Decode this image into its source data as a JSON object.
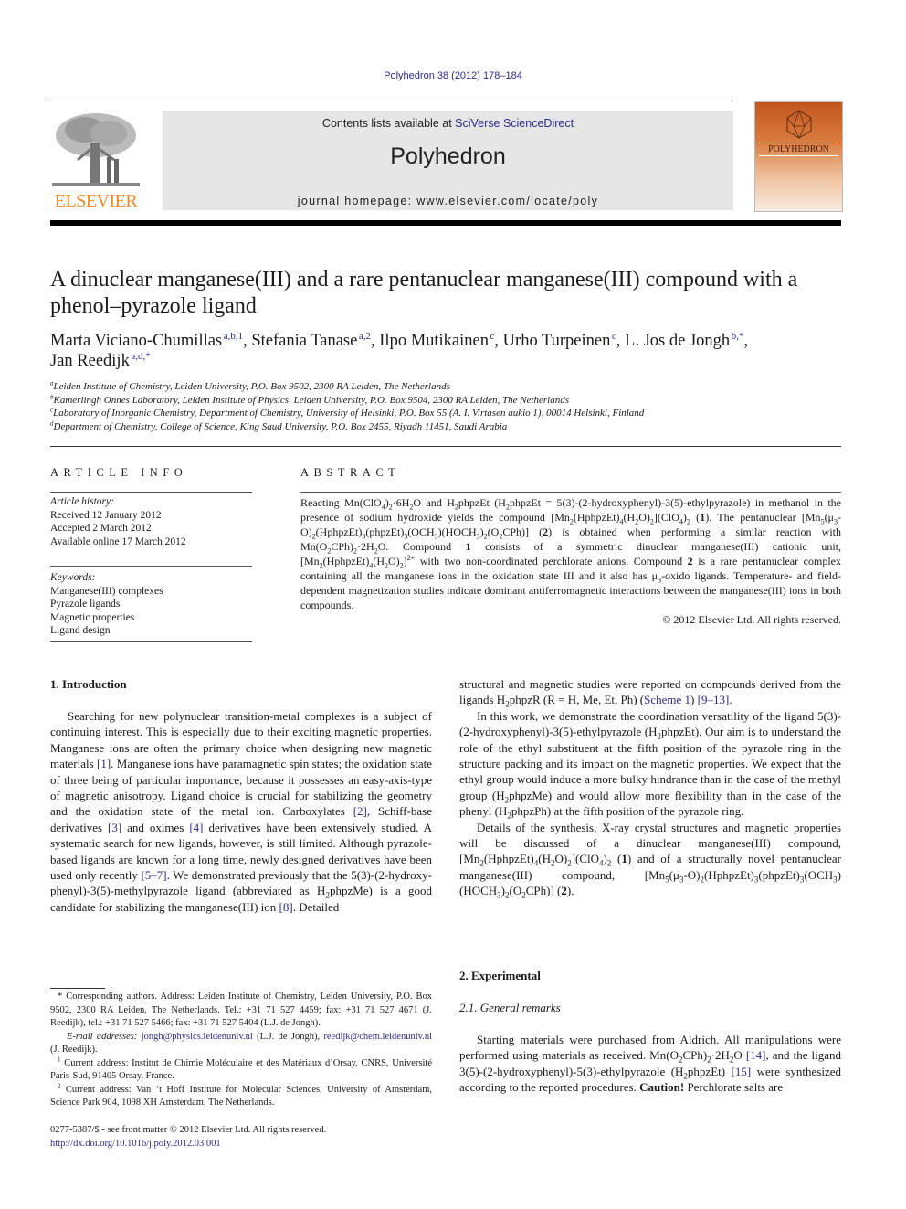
{
  "header": {
    "journal_ref": "Polyhedron 38 (2012) 178–184",
    "contents_prefix": "Contents lists available at ",
    "contents_link": "SciVerse ScienceDirect",
    "journal_title": "Polyhedron",
    "homepage": "journal homepage: www.elsevier.com/locate/poly",
    "publisher_logo_text": "ELSEVIER",
    "cover_title": "POLYHEDRON",
    "colors": {
      "link": "#2b2b8a",
      "elsevier_orange": "#f08a24",
      "masthead_bg": "#e6e6e6",
      "cover_orange": "#c2561e"
    }
  },
  "article": {
    "title": "A dinuclear manganese(III) and a rare pentanuclear manganese(III) compound with a phenol–pyrazole ligand",
    "authors": [
      {
        "name": "Marta Viciano-Chumillas",
        "marks": "a,b,1",
        "sep": ", "
      },
      {
        "name": "Stefania Tanase",
        "marks": "a,2",
        "sep": ", "
      },
      {
        "name": "Ilpo Mutikainen",
        "marks": "c",
        "sep": ", "
      },
      {
        "name": "Urho Turpeinen",
        "marks": "c",
        "sep": ", "
      },
      {
        "name": "L. Jos de Jongh",
        "marks": "b,*",
        "sep": ","
      },
      {
        "name": "Jan Reedijk",
        "marks": "a,d,*",
        "sep": ""
      }
    ],
    "affiliations": [
      {
        "mark": "a",
        "text": "Leiden Institute of Chemistry, Leiden University, P.O. Box 9502, 2300 RA Leiden, The Netherlands"
      },
      {
        "mark": "b",
        "text": "Kamerlingh Onnes Laboratory, Leiden Institute of Physics, Leiden University, P.O. Box 9504, 2300 RA Leiden, The Netherlands"
      },
      {
        "mark": "c",
        "text": "Laboratory of Inorganic Chemistry, Department of Chemistry, University of Helsinki, P.O. Box 55 (A. I. Virtasen aukio 1), 00014 Helsinki, Finland"
      },
      {
        "mark": "d",
        "text": "Department of Chemistry, College of Science, King Saud University, P.O. Box 2455, Riyadh 11451, Saudi Arabia"
      }
    ]
  },
  "article_info": {
    "heading": "ARTICLE INFO",
    "history_label": "Article history:",
    "history": [
      "Received 12 January 2012",
      "Accepted 2 March 2012",
      "Available online 17 March 2012"
    ],
    "keywords_label": "Keywords:",
    "keywords": [
      "Manganese(III) complexes",
      "Pyrazole ligands",
      "Magnetic properties",
      "Ligand design"
    ]
  },
  "abstract": {
    "heading": "ABSTRACT",
    "p1": "Reacting Mn(ClO",
    "p2": ")",
    "p3": "·6H",
    "p4": "O and H",
    "p5": "phpzEt (H",
    "p6": "phpzEt = 5(3)-(2-hydroxyphenyl)-3(5)-ethylpyrazole) in methanol in the presence of sodium hydroxide yields the compound [Mn",
    "p7": "(HphpzEt)",
    "p8": "(H",
    "p9": "O)",
    "p10": "](ClO",
    "p11": ")",
    "p12": " (",
    "c1": "1",
    "p13": "). The pentanuclear [Mn",
    "p14": "(μ",
    "p15": "-O)",
    "p16": "(HphpzEt)",
    "p17": "(phpzEt)",
    "p18": "(OCH",
    "p19": ")(HOCH",
    "p20": ")",
    "p21": "(O",
    "p22": "CPh)] (",
    "c2": "2",
    "p23": ") is obtained when performing a similar reaction with Mn(O",
    "p24": "CPh)",
    "p25": "·2H",
    "p26": "O. Compound ",
    "p27": " consists of a symmetric dinuclear manganese(III) cationic unit, [Mn",
    "p28": "(HphpzEt)",
    "p29": "(H",
    "p30": "O)",
    "p31": "]",
    "p32": " with two non-coordinated perchlorate anions. Compound ",
    "p33": " is a rare pentanuclear complex containing all the manganese ions in the oxidation state III and it also has μ",
    "p34": "-oxido ligands. Temperature- and field-dependent magnetization studies indicate dominant antiferromagnetic interactions between the manganese(III) ions in both compounds.",
    "copyright": "© 2012 Elsevier Ltd. All rights reserved."
  },
  "body": {
    "intro_heading": "1. Introduction",
    "intro_p1": [
      "Searching for new polynuclear transition-metal complexes is a subject of continuing interest. This is especially due to their exciting magnetic properties. Manganese ions are often the primary choice when designing new magnetic materials ",
      "[1]",
      ". Manganese ions have paramagnetic spin states; the oxidation state of three being of particular importance, because it possesses an easy-axis-type of magnetic anisotropy. Ligand choice is crucial for stabilizing the geometry and the oxidation state of the metal ion. Carboxylates ",
      "[2]",
      ", Schiff-base derivatives ",
      "[3]",
      " and oximes ",
      "[4]",
      " derivatives have been extensively studied. A systematic search for new ligands, however, is still limited. Although pyrazole-based ligands are known for a long time, newly designed derivatives have been used only recently ",
      "[5–7]",
      ". We demonstrated previously that the 5(3)-(2-hydroxy-phenyl)-3(5)-methylpyrazole ligand (abbreviated as H",
      "2",
      "phpzMe) is a good candidate for stabilizing the manganese(III) ion ",
      "[8]",
      ". Detailed"
    ],
    "right_p0": [
      "structural and magnetic studies were reported on compounds derived from the ligands H",
      "2",
      "phpzR (R = H, Me, Et, Ph) (",
      "Scheme 1",
      ") ",
      "[9–13]",
      "."
    ],
    "right_p1": [
      "In this work, we demonstrate the coordination versatility of the ligand 5(3)-(2-hydroxyphenyl)-3(5)-ethylpyrazole (H",
      "2",
      "phpzEt). Our aim is to understand the role of the ethyl substituent at the fifth position of the pyrazole ring in the structure packing and its impact on the magnetic properties. We expect that the ethyl group would induce a more bulky hindrance than in the case of the methyl group (H",
      "2",
      "phpzMe) and would allow more flexibility than in the case of the phenyl (H",
      "2",
      "phpzPh) at the fifth position of the pyrazole ring."
    ],
    "right_p2": [
      "Details of the synthesis, X-ray crystal structures and magnetic properties will be discussed of a dinuclear manganese(III) compound, [Mn",
      "2",
      "(HphpzEt)",
      "4",
      "(H",
      "2",
      "O)",
      "2",
      "](ClO",
      "4",
      ")",
      "2",
      " (",
      "1",
      ") and of a structurally novel pentanuclear manganese(III) compound, [Mn",
      "5",
      "(μ",
      "3",
      "-O)",
      "2",
      "(HphpzEt)",
      "3",
      "(phpzEt)",
      "3",
      "(OCH",
      "3",
      ")(HOCH",
      "3",
      ")",
      "2",
      "(O",
      "2",
      "CPh)] (",
      "2",
      ")."
    ],
    "exp_heading": "2. Experimental",
    "sub_heading": "2.1. General remarks",
    "exp_p1": [
      "Starting materials were purchased from Aldrich. All manipulations were performed using materials as received. Mn(O",
      "2",
      "CPh)",
      "2",
      "·2H",
      "2",
      "O ",
      "[14]",
      ", and the ligand 3(5)-(2-hydroxyphenyl)-5(3)-ethylpyrazole (H",
      "2",
      "phpzEt) ",
      "[15]",
      " were synthesized according to the reported procedures. ",
      "Caution!",
      " Perchlorate salts are"
    ]
  },
  "footnotes": {
    "corresponding": "* Corresponding authors. Address: Leiden Institute of Chemistry, Leiden University, P.O. Box 9502, 2300 RA Leiden, The Netherlands. Tel.: +31 71 527 4459; fax: +31 71 527 4671 (J. Reedijk), tel.: +31 71 527 5466; fax: +31 71 527 5404 (L.J. de Jongh).",
    "email_label": "E-mail addresses:",
    "email1": "jongh@physics.leidenuniv.nl",
    "email1_owner": " (L.J. de Jongh), ",
    "email2": "reedijk@chem.leidenuniv.nl",
    "email2_owner": " (J. Reedijk).",
    "fn1_mark": "1",
    "fn1": " Current address: Institut de Chimie Moléculaire et des Matériaux d’Orsay, CNRS, Université Paris-Sud, 91405 Orsay, France.",
    "fn2_mark": "2",
    "fn2": " Current address: Van ‘t Hoff Institute for Molecular Sciences, University of Amsterdam, Science Park 904, 1098 XH Amsterdam, The Netherlands.",
    "front_matter": "0277-5387/$ - see front matter © 2012 Elsevier Ltd. All rights reserved.",
    "doi": "http://dx.doi.org/10.1016/j.poly.2012.03.001"
  }
}
